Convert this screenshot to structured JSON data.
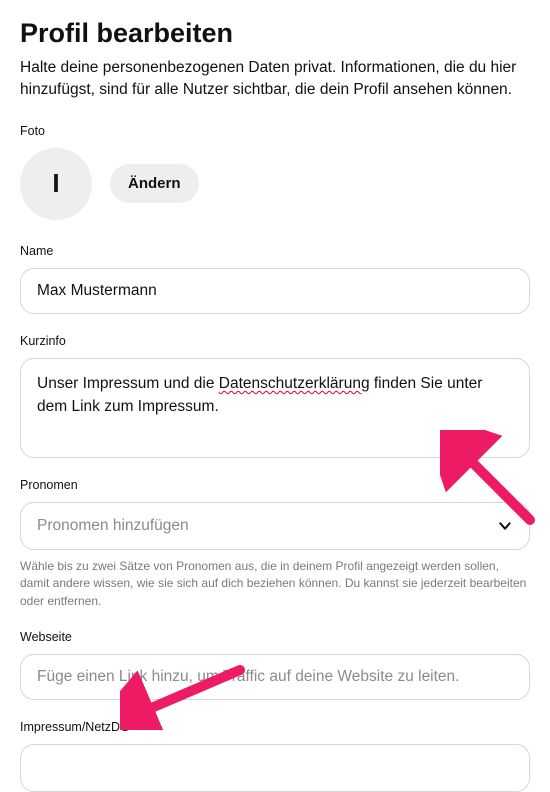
{
  "title": "Profil bearbeiten",
  "subtitle": "Halte deine personenbezogenen Daten privat. Informationen, die du hier hinzufügst, sind für alle Nutzer sichtbar, die dein Profil ansehen können.",
  "photo": {
    "label": "Foto",
    "initial": "I",
    "change_label": "Ändern"
  },
  "name": {
    "label": "Name",
    "value": "Max Mustermann"
  },
  "bio": {
    "label": "Kurzinfo",
    "value_pre": "Unser Impressum und die ",
    "value_spellerr": "Datenschutzerklärung",
    "value_post": " finden Sie unter dem Link zum Impressum."
  },
  "pronouns": {
    "label": "Pronomen",
    "placeholder": "Pronomen hinzufügen",
    "helper": "Wähle bis zu zwei Sätze von Pronomen aus, die in deinem Profil angezeigt werden sollen, damit andere wissen, wie sie sich auf dich beziehen können. Du kannst sie jederzeit bearbeiten oder entfernen."
  },
  "website": {
    "label": "Webseite",
    "placeholder": "Füge einen Link hinzu, um Traffic auf deine Website zu leiten."
  },
  "impressum": {
    "label": "Impressum/NetzDG",
    "value": ""
  },
  "colors": {
    "arrow": "#ec1b63"
  }
}
